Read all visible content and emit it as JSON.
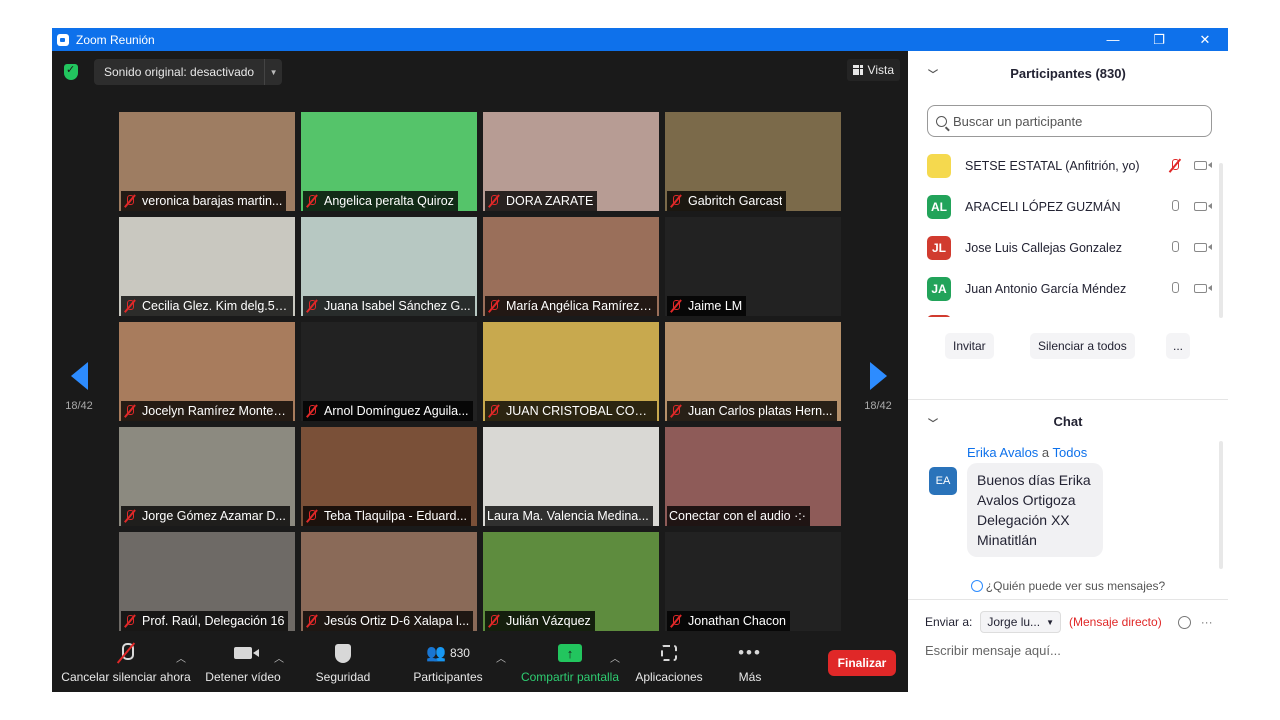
{
  "window": {
    "title": "Zoom Reunión",
    "controls": [
      "—",
      "❐",
      "✕"
    ]
  },
  "topbar": {
    "sound_label": "Sonido original: desactivado",
    "view_label": "Vista"
  },
  "pagination": {
    "left": "18/42",
    "right": "18/42"
  },
  "tiles": [
    {
      "name": "veronica barajas martin...",
      "muted": true,
      "bg": "#2a2a2a",
      "photo": "#9e7d62"
    },
    {
      "name": "Angelica peralta Quiroz",
      "muted": true,
      "bg": "#2a2a2a",
      "photo": "#55c46a"
    },
    {
      "name": "DORA ZARATE",
      "muted": true,
      "bg": "#2a2a2a",
      "photo": "#b79c94"
    },
    {
      "name": "Gabritch Garcast",
      "muted": true,
      "bg": "#2a2a2a",
      "photo": "#7b6a4a"
    },
    {
      "name": "Cecilia Glez. Kim delg.51...",
      "muted": true,
      "bg": "#2a2a2a",
      "photo": "#c9c8c0"
    },
    {
      "name": "Juana Isabel Sánchez G...",
      "muted": true,
      "bg": "#2a2a2a",
      "photo": "#b7c8c2"
    },
    {
      "name": "María Angélica Ramírez ...",
      "muted": true,
      "bg": "#2a2a2a",
      "photo": "#9a6f5a"
    },
    {
      "name": "Jaime LM",
      "muted": true,
      "bg": "#222222",
      "photo": ""
    },
    {
      "name": "Jocelyn Ramírez Montes...",
      "muted": true,
      "bg": "#2a2a2a",
      "photo": "#a87c5d"
    },
    {
      "name": "Arnol Domínguez Aguila...",
      "muted": true,
      "bg": "#222222",
      "photo": ""
    },
    {
      "name": "JUAN CRISTOBAL CORIA...",
      "muted": true,
      "bg": "#2a2a2a",
      "photo": "#c8a94e"
    },
    {
      "name": "Juan Carlos platas Hern...",
      "muted": true,
      "bg": "#2a2a2a",
      "photo": "#b5906a"
    },
    {
      "name": "Jorge Gómez Azamar D...",
      "muted": true,
      "bg": "#2a2a2a",
      "photo": "#8c8a80"
    },
    {
      "name": "Teba Tlaquilpa - Eduard...",
      "muted": true,
      "bg": "#2a2a2a",
      "photo": "#7a5038"
    },
    {
      "name": "Laura Ma. Valencia Medina...",
      "muted": false,
      "bg": "#2a2a2a",
      "photo": "#d9d8d4"
    },
    {
      "name": "Conectar con el audio ·:·",
      "muted": false,
      "bg": "#2a2a2a",
      "photo": "#8e5b58"
    },
    {
      "name": "Prof.  Raúl, Delegación 16",
      "muted": true,
      "bg": "#2a2a2a",
      "photo": "#6e6a66"
    },
    {
      "name": "Jesús Ortiz D-6 Xalapa l...",
      "muted": true,
      "bg": "#2a2a2a",
      "photo": "#8a6a58"
    },
    {
      "name": "Julián Vázquez",
      "muted": true,
      "bg": "#2a2a2a",
      "photo": "#5e8c3e"
    },
    {
      "name": "Jonathan Chacon",
      "muted": true,
      "bg": "#222222",
      "photo": ""
    }
  ],
  "toolbar": {
    "mute": "Cancelar silenciar ahora",
    "video": "Detener vídeo",
    "security": "Seguridad",
    "participants": "Participantes",
    "participants_count": "830",
    "share": "Compartir pantalla",
    "apps": "Aplicaciones",
    "more": "Más",
    "end": "Finalizar"
  },
  "participants_panel": {
    "title": "Participantes (830)",
    "search_placeholder": "Buscar un participante",
    "list": [
      {
        "initials": "",
        "name": "SETSE ESTATAL (Anfitrión, yo)",
        "color": "#f5d94e",
        "muted": true
      },
      {
        "initials": "AL",
        "name": "ARACELI LÓPEZ GUZMÁN",
        "color": "#22a35a",
        "muted": false
      },
      {
        "initials": "JL",
        "name": "Jose Luis Callejas Gonzalez",
        "color": "#d13b2f",
        "muted": false
      },
      {
        "initials": "JA",
        "name": "Juan Antonio García Méndez",
        "color": "#22a35a",
        "muted": false
      }
    ],
    "invite": "Invitar",
    "mute_all": "Silenciar a todos",
    "more": "..."
  },
  "chat": {
    "title": "Chat",
    "sender": "Erika Avalos",
    "to_word": "a",
    "recipient": "Todos",
    "avatar": "EA",
    "message": "Buenos días Erika Avalos Ortigoza Delegación XX Minatitlán",
    "who_can_see": "¿Quién puede ver sus mensajes?",
    "send_to_label": "Enviar a:",
    "send_to_value": "Jorge lu...",
    "direct": "(Mensaje directo)",
    "more": "···",
    "input_placeholder": "Escribir mensaje aquí..."
  }
}
